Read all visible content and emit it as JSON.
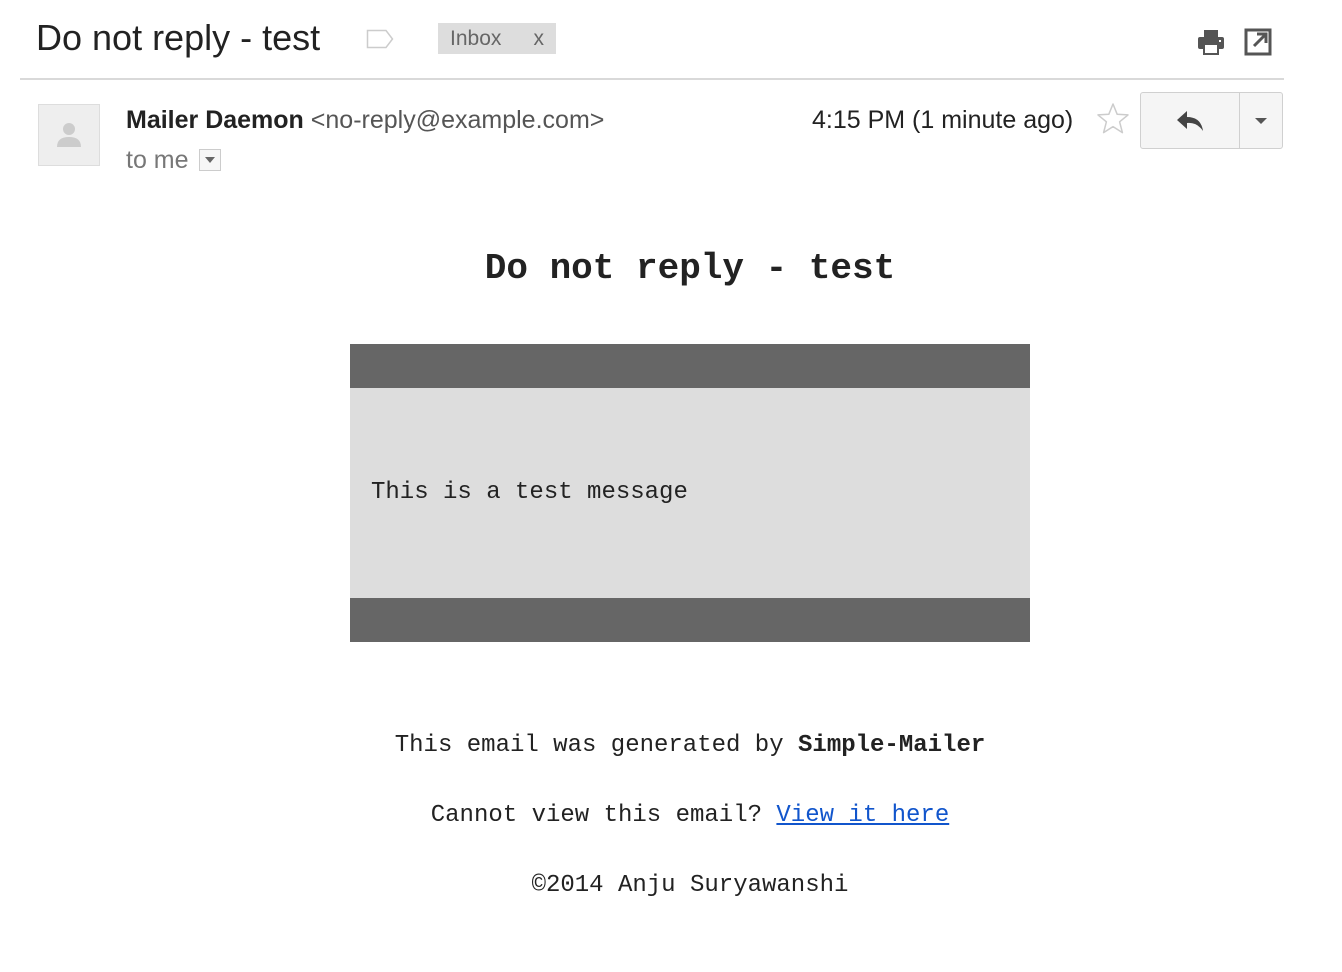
{
  "subject": {
    "title": "Do not reply - test",
    "label_chip": "Inbox",
    "label_chip_remove": "x"
  },
  "toolbar": {
    "print_icon": "printer-icon",
    "new_window_icon": "open-in-new-window-icon"
  },
  "message_header": {
    "sender_name": "Mailer Daemon",
    "sender_email": "<no-reply@example.com>",
    "recipient": "to me",
    "timestamp": "4:15 PM (1 minute ago)",
    "avatar_icon": "person-icon",
    "star_icon": "star-outline-icon",
    "reply_icon": "reply-arrow-icon",
    "more_icon": "caret-down-icon"
  },
  "body": {
    "title": "Do not reply - test",
    "message": "This is a test message",
    "generated_prefix": "This email was generated by ",
    "generated_brand": "Simple-Mailer",
    "view_prefix": "Cannot view this email? ",
    "view_link": "View it here",
    "copyright": "©2014 Anju Suryawanshi"
  },
  "colors": {
    "card_bar": "#666666",
    "card_body": "#dddddd",
    "link": "#1155cc",
    "chip_background": "#dddddd"
  }
}
